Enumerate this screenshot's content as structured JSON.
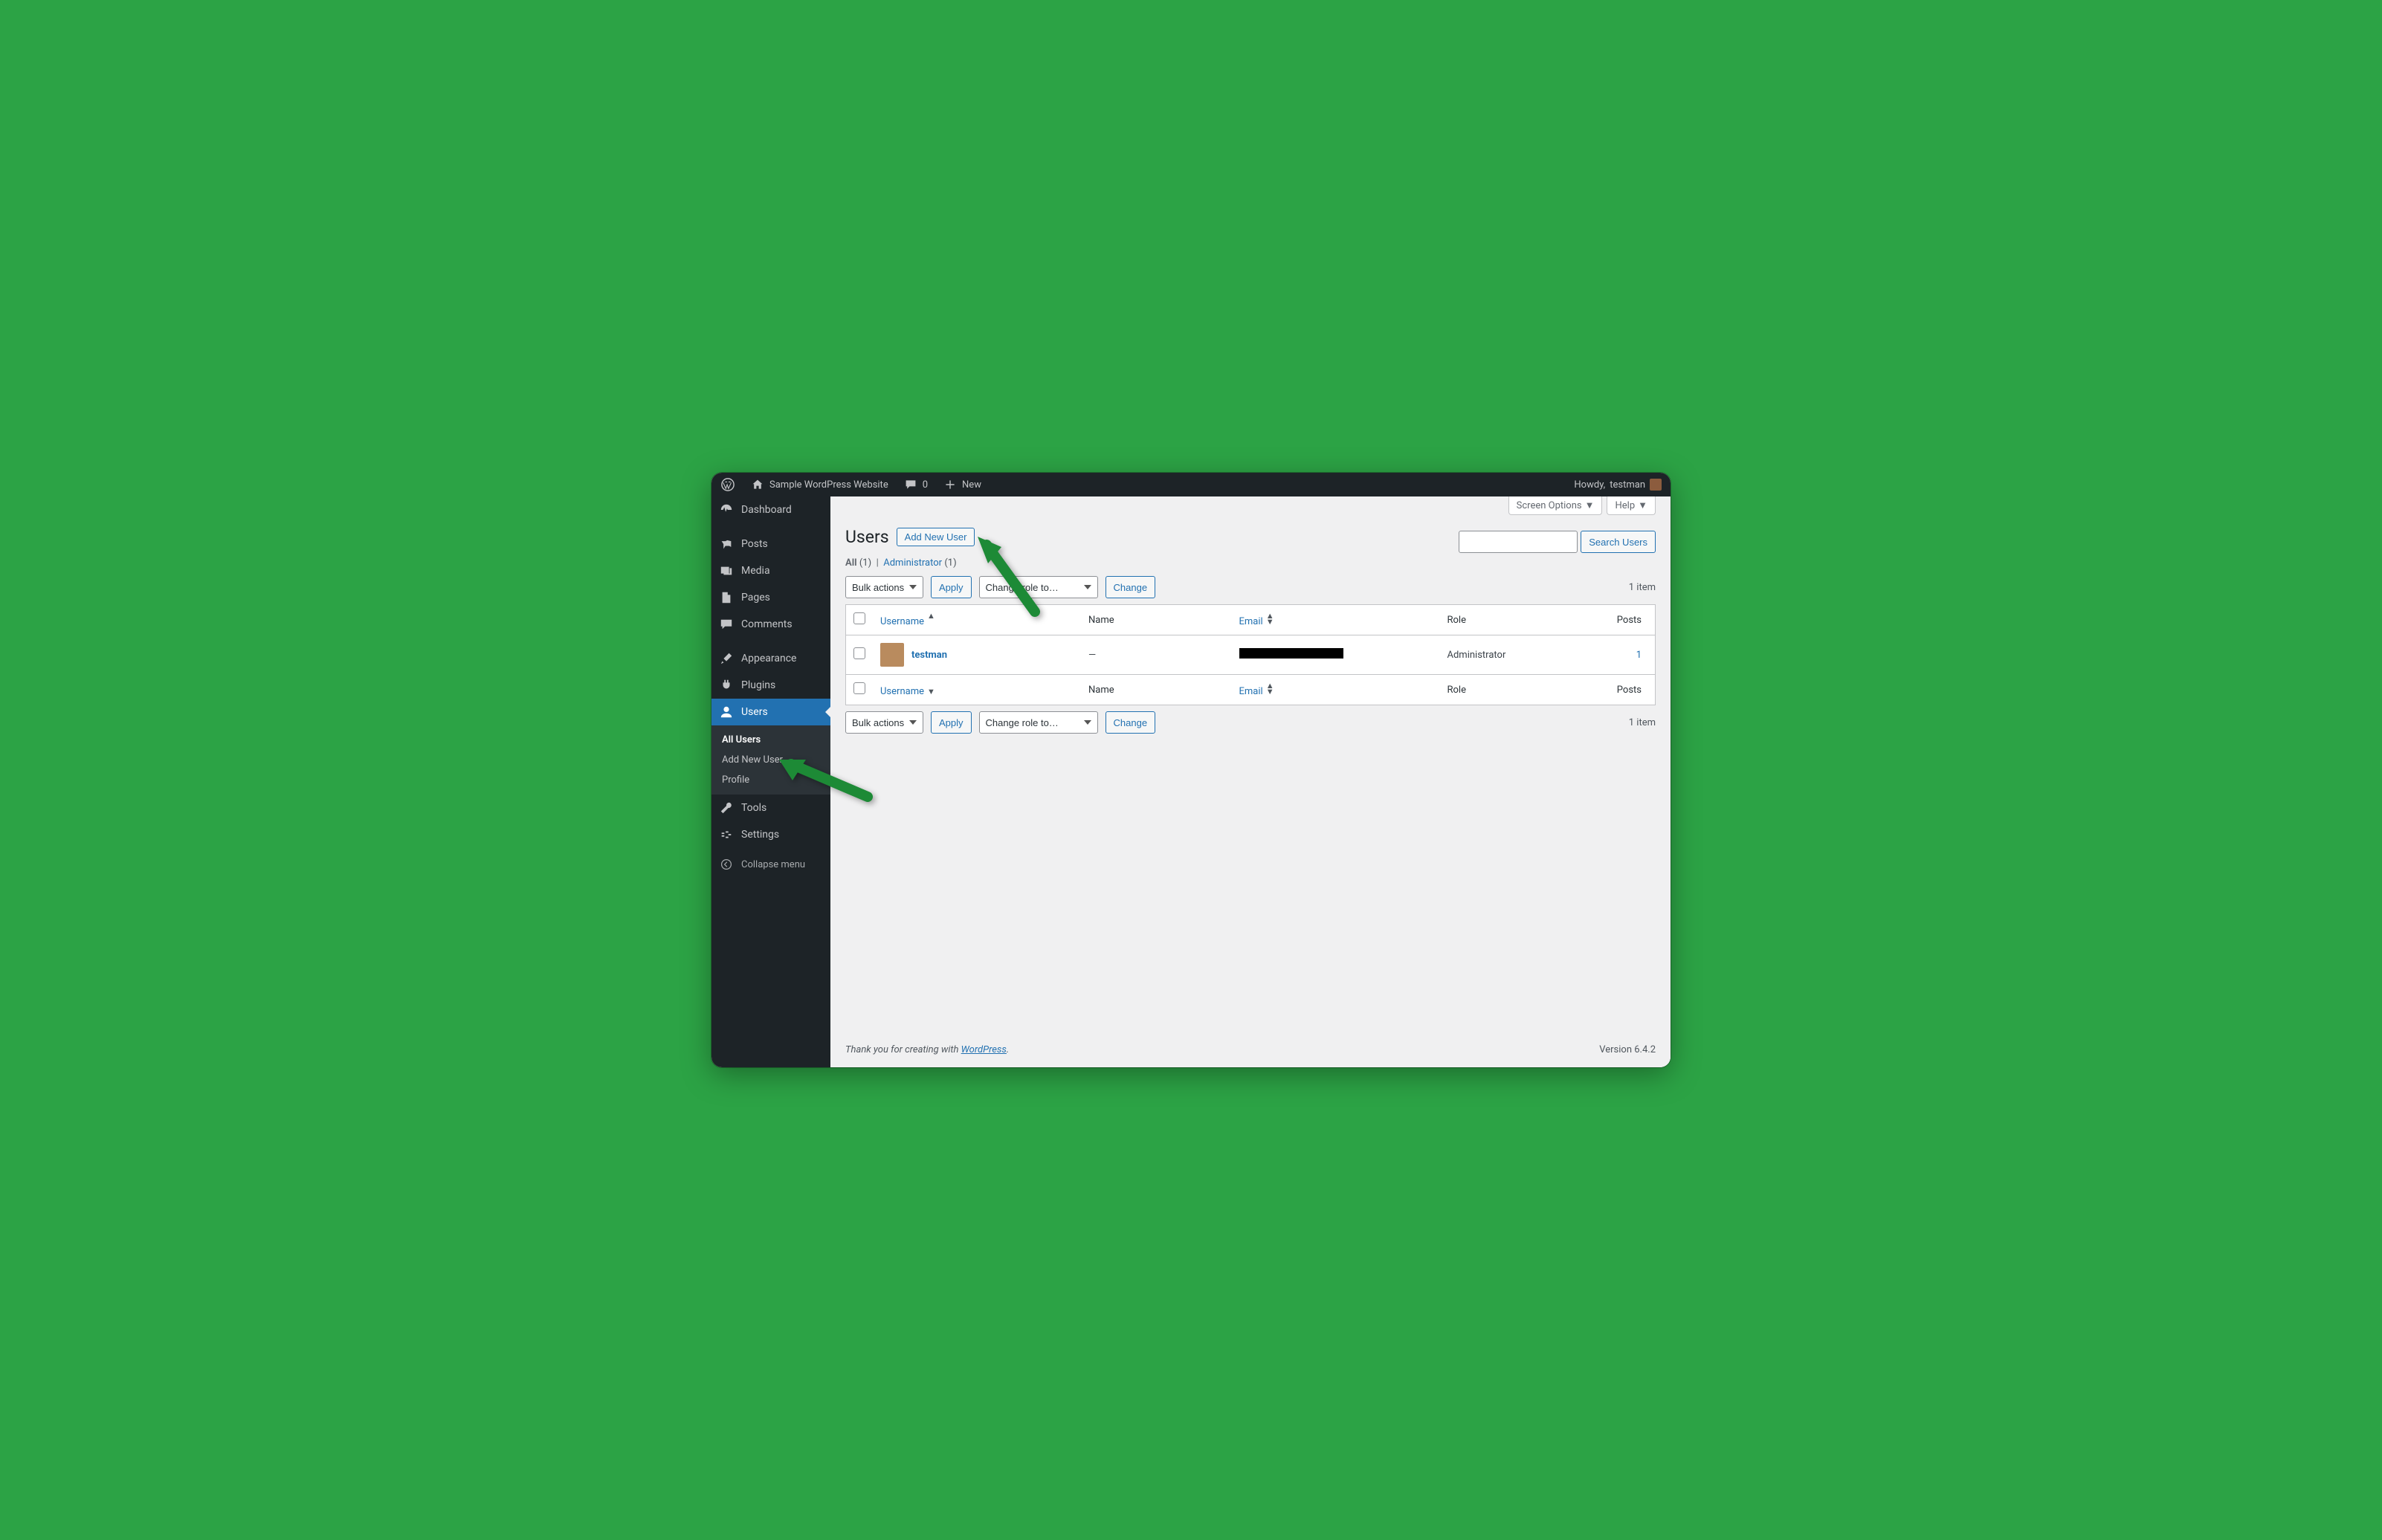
{
  "adminbar": {
    "site_name": "Sample WordPress Website",
    "comments_count": "0",
    "new_label": "New",
    "howdy_prefix": "Howdy, ",
    "username": "testman"
  },
  "sidebar": {
    "items": [
      {
        "icon": "dashboard-icon",
        "label": "Dashboard"
      },
      {
        "icon": "pin-icon",
        "label": "Posts"
      },
      {
        "icon": "media-icon",
        "label": "Media"
      },
      {
        "icon": "page-icon",
        "label": "Pages"
      },
      {
        "icon": "comment-icon",
        "label": "Comments"
      },
      {
        "icon": "brush-icon",
        "label": "Appearance"
      },
      {
        "icon": "plug-icon",
        "label": "Plugins"
      },
      {
        "icon": "user-icon",
        "label": "Users"
      },
      {
        "icon": "wrench-icon",
        "label": "Tools"
      },
      {
        "icon": "settings-icon",
        "label": "Settings"
      }
    ],
    "users_submenu": [
      {
        "label": "All Users",
        "current": true
      },
      {
        "label": "Add New User"
      },
      {
        "label": "Profile"
      }
    ],
    "collapse_label": "Collapse menu"
  },
  "screen_meta": {
    "screen_options": "Screen Options",
    "help": "Help"
  },
  "page": {
    "title": "Users",
    "add_new": "Add New User",
    "filters": {
      "all_label": "All",
      "all_count": "(1)",
      "admin_label": "Administrator",
      "admin_count": "(1)"
    },
    "bulk_actions": "Bulk actions",
    "apply": "Apply",
    "change_role": "Change role to…",
    "change": "Change",
    "item_count": "1 item",
    "search_button": "Search Users",
    "columns": {
      "username": "Username",
      "name": "Name",
      "email": "Email",
      "role": "Role",
      "posts": "Posts"
    },
    "rows": [
      {
        "username": "testman",
        "name": "—",
        "email_redacted": true,
        "role": "Administrator",
        "posts": "1"
      }
    ]
  },
  "footer": {
    "thanks_prefix": "Thank you for creating with ",
    "wp_link": "WordPress",
    "thanks_suffix": ".",
    "version": "Version 6.4.2"
  }
}
